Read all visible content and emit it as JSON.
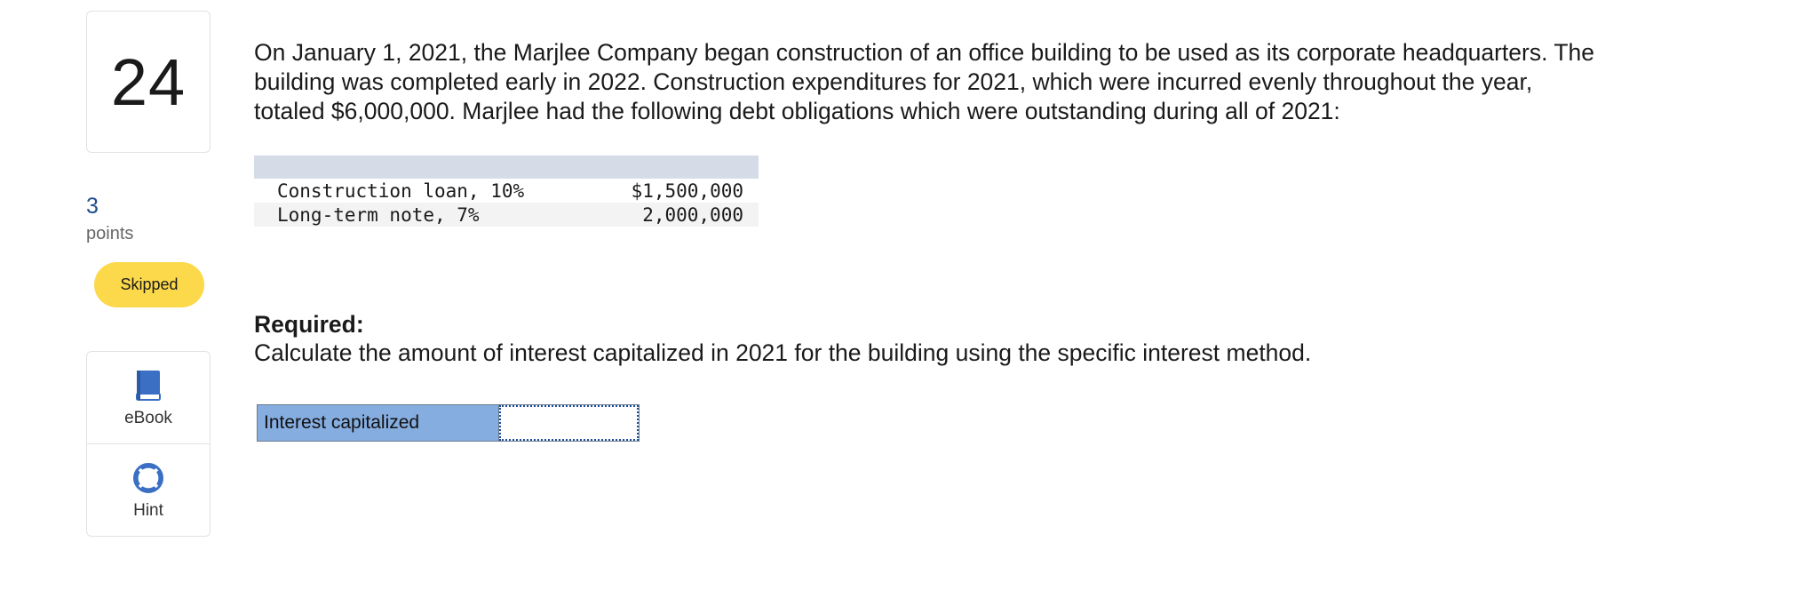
{
  "question": {
    "number": "24",
    "points_value": "3",
    "points_label": "points",
    "status": "Skipped",
    "status_color": "#fcd94a"
  },
  "tools": {
    "ebook_label": "eBook",
    "ebook_icon": "book-icon",
    "hint_label": "Hint",
    "hint_icon": "lifebuoy-icon",
    "icon_color": "#3a6fc4"
  },
  "prompt": {
    "line1": "On January 1, 2021, the Marjlee Company began construction of an office building to be used as its corporate headquarters. The",
    "line2": "building was completed early in 2022. Construction expenditures for 2021, which were incurred evenly throughout the year,",
    "line3": "totaled $6,000,000. Marjlee had the following debt obligations which were outstanding during all of 2021:"
  },
  "debt_table": {
    "rows": [
      {
        "label": "Construction loan, 10%",
        "amount": "$1,500,000"
      },
      {
        "label": "Long-term note, 7%",
        "amount": "2,000,000"
      }
    ]
  },
  "required": {
    "title": "Required:",
    "text": "Calculate the amount of interest capitalized in 2021 for the building using the specific interest method."
  },
  "answer": {
    "label": "Interest capitalized",
    "value": ""
  }
}
